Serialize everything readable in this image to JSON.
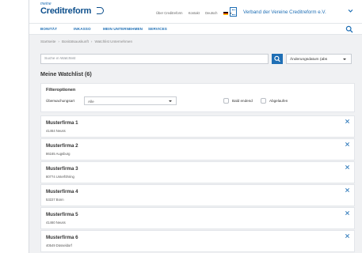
{
  "header": {
    "logo_small": "meine",
    "logo": "Creditreform",
    "links": [
      "Über Creditreform",
      "Kontakt",
      "Deutsch"
    ],
    "organization": "Verband der Vereine Creditreform e.V."
  },
  "nav": {
    "items": [
      "BONITÄT",
      "INKASSO",
      "MEIN UNTERNEHMEN",
      "SERVICES"
    ]
  },
  "breadcrumb": [
    "Startseite",
    "Bonitätsauskunft",
    "Watchlist Unternehmen"
  ],
  "search": {
    "placeholder": "Suche in Watchlist",
    "sort_value": "Änderungsdatum (abs"
  },
  "watchlist": {
    "title": "Meine Watchlist (6)"
  },
  "filter": {
    "title": "Filteroptionen",
    "label": "Überwachungsart",
    "select_value": "Alle",
    "options": [
      "Bald endend",
      "Abgelaufen"
    ]
  },
  "companies": [
    {
      "name": "Musterfirma 1",
      "address": "41464 Neuss"
    },
    {
      "name": "Musterfirma 2",
      "address": "86165 Augsburg"
    },
    {
      "name": "Musterfirma 3",
      "address": "80774 Unterföhring"
    },
    {
      "name": "Musterfirma 4",
      "address": "53227 Bonn"
    },
    {
      "name": "Musterfirma 5",
      "address": "41460 Neuss"
    },
    {
      "name": "Musterfirma 6",
      "address": "40549 Düsseldorf"
    }
  ],
  "colors": {
    "brand": "#1f6fb5",
    "brand_dark": "#0d4f8c",
    "background": "#f0f1f3"
  }
}
